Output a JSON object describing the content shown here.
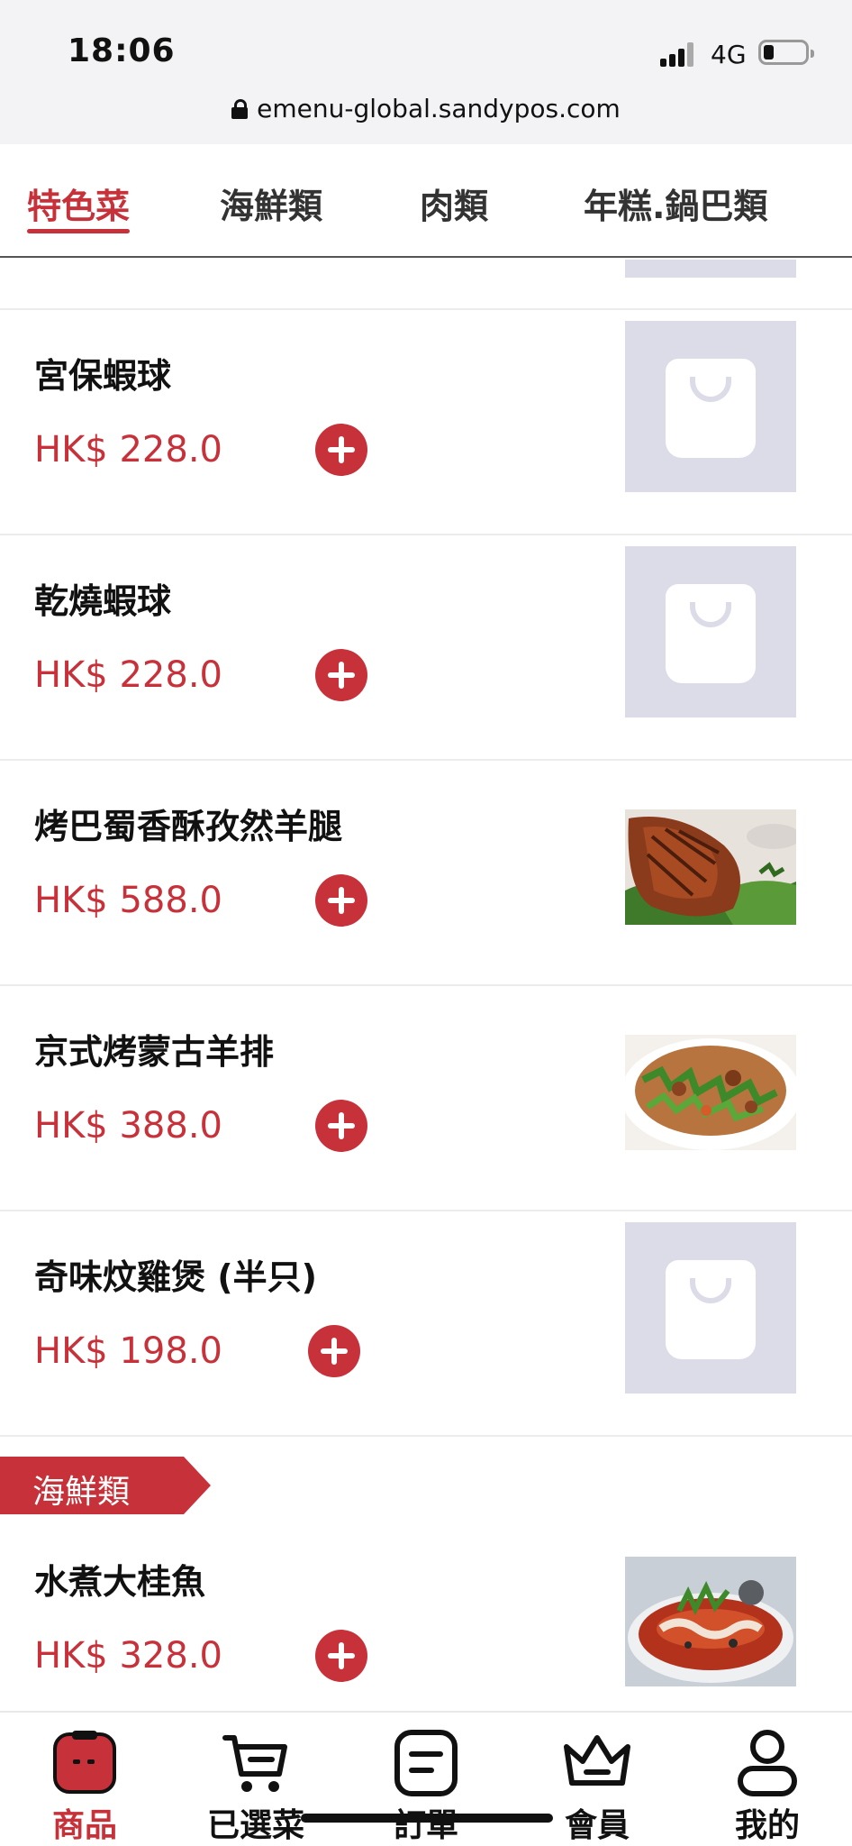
{
  "status_bar": {
    "time": "18:06",
    "network": "4G",
    "url": "emenu-global.sandypos.com"
  },
  "tabs": [
    {
      "label": "特色菜",
      "active": true
    },
    {
      "label": "海鮮類",
      "active": false
    },
    {
      "label": "肉類",
      "active": false
    },
    {
      "label": "年糕.鍋巴類",
      "active": false
    }
  ],
  "items": [
    {
      "name": "宮保蝦球",
      "price": "HK$ 228.0",
      "image": "placeholder-bag-icon"
    },
    {
      "name": "乾燒蝦球",
      "price": "HK$ 228.0",
      "image": "placeholder-bag-icon"
    },
    {
      "name": "烤巴蜀香酥孜然羊腿",
      "price": "HK$ 588.0",
      "image": "roast-lamb-leg-photo"
    },
    {
      "name": "京式烤蒙古羊排",
      "price": "HK$ 388.0",
      "image": "lamb-ribs-salad-photo"
    },
    {
      "name": "奇味炆雞煲 (半只)",
      "price": "HK$ 198.0",
      "image": "placeholder-bag-icon"
    }
  ],
  "section": {
    "label": "海鮮類",
    "items": [
      {
        "name": "水煮大桂魚",
        "price": "HK$ 328.0",
        "image": "boiled-fish-photo"
      }
    ]
  },
  "bottom_nav": [
    {
      "label": "商品",
      "icon": "product-bag-icon",
      "active": true
    },
    {
      "label": "已選菜",
      "icon": "cart-icon",
      "active": false
    },
    {
      "label": "訂單",
      "icon": "order-list-icon",
      "active": false
    },
    {
      "label": "會員",
      "icon": "crown-icon",
      "active": false
    },
    {
      "label": "我的",
      "icon": "user-profile-icon",
      "active": false
    }
  ],
  "colors": {
    "accent": "#c7313a",
    "placeholder_bg": "#dcdce8",
    "status_bar_bg": "#f3f3f5"
  }
}
